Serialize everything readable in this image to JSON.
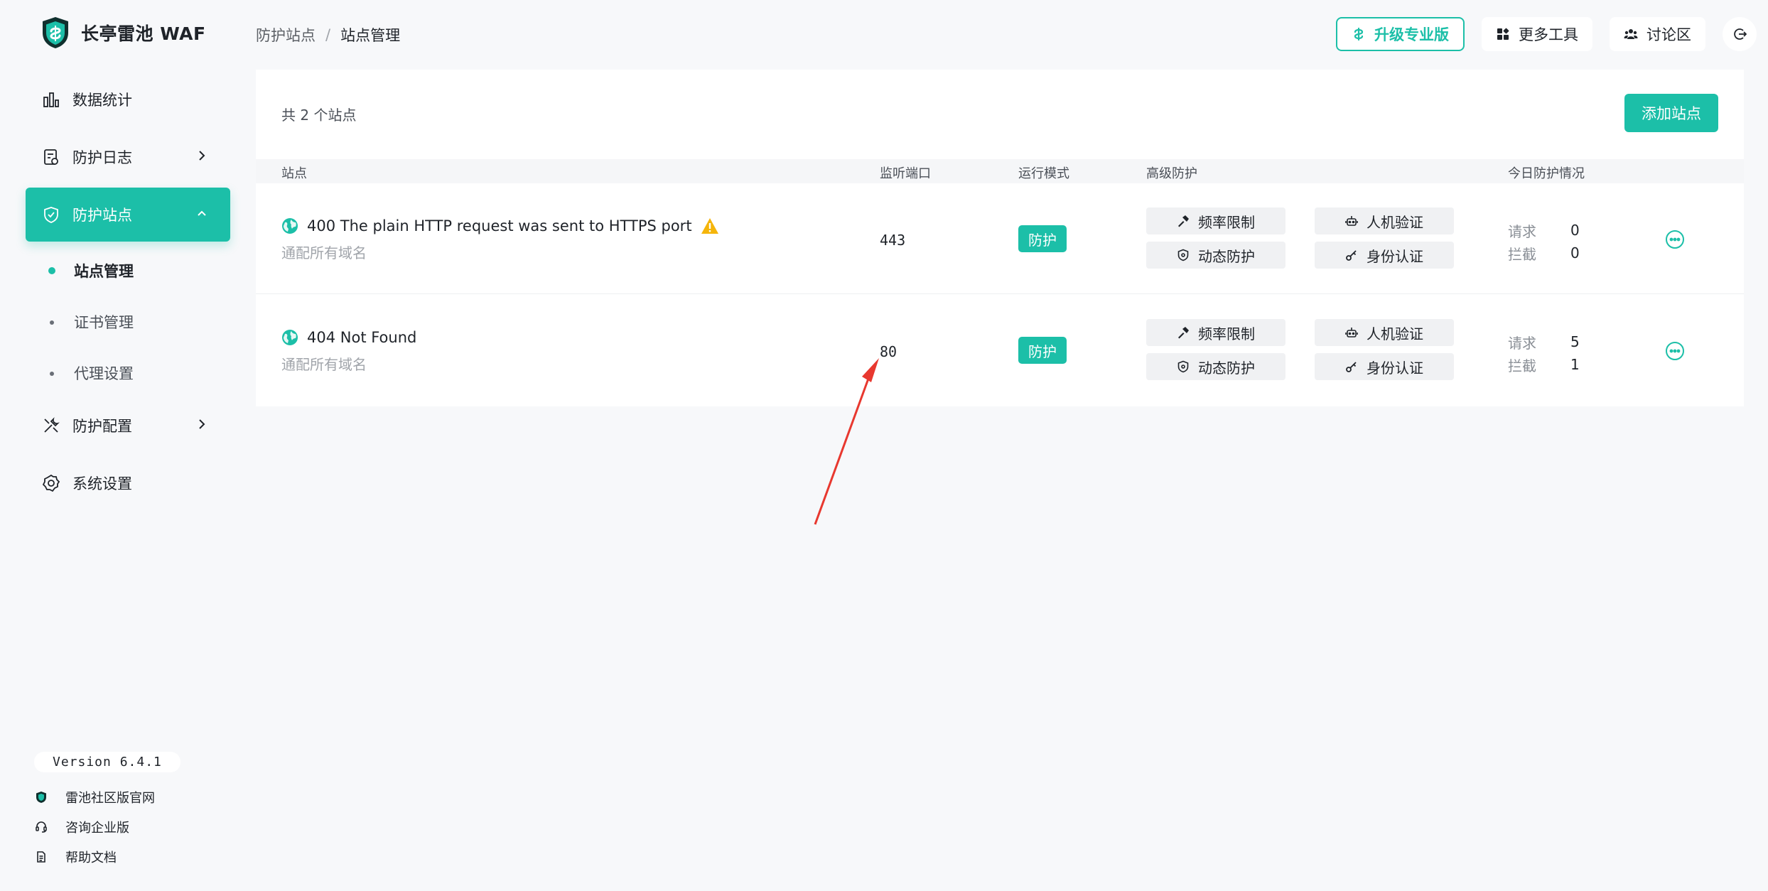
{
  "app": {
    "name": "长亭雷池 WAF"
  },
  "breadcrumb": {
    "parent": "防护站点",
    "separator": "/",
    "current": "站点管理"
  },
  "topbar": {
    "pro_label": "升级专业版",
    "tools_label": "更多工具",
    "forum_label": "讨论区"
  },
  "nav": {
    "items": [
      {
        "label": "数据统计"
      },
      {
        "label": "防护日志"
      },
      {
        "label": "防护站点"
      },
      {
        "label": "防护配置"
      },
      {
        "label": "系统设置"
      }
    ],
    "sub_items": [
      {
        "label": "站点管理"
      },
      {
        "label": "证书管理"
      },
      {
        "label": "代理设置"
      }
    ]
  },
  "footer": {
    "version": "Version 6.4.1",
    "links": [
      {
        "label": "雷池社区版官网"
      },
      {
        "label": "咨询企业版"
      },
      {
        "label": "帮助文档"
      }
    ]
  },
  "card": {
    "count_text": "共 2 个站点",
    "add_label": "添加站点"
  },
  "table": {
    "headers": {
      "site": "站点",
      "port": "监听端口",
      "mode": "运行模式",
      "advanced": "高级防护",
      "today": "今日防护情况"
    },
    "tags": {
      "rate": "频率限制",
      "captcha": "人机验证",
      "dynamic": "动态防护",
      "auth": "身份认证"
    },
    "stat_labels": {
      "req": "请求",
      "block": "拦截"
    },
    "rows": [
      {
        "title": "400 The plain HTTP request was sent to HTTPS port",
        "subtitle": "通配所有域名",
        "port": "443",
        "mode": "防护",
        "req": "0",
        "block": "0",
        "warning": true
      },
      {
        "title": "404 Not Found",
        "subtitle": "通配所有域名",
        "port": "80",
        "mode": "防护",
        "req": "5",
        "block": "1",
        "warning": false
      }
    ]
  },
  "colors": {
    "accent": "#1cbfa8",
    "warning": "#f5b50a",
    "annotation": "#e8382f"
  }
}
